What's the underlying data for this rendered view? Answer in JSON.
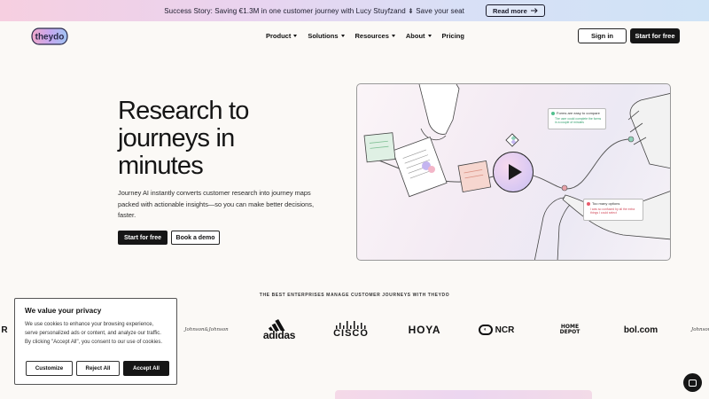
{
  "announcement": {
    "text": "Success Story: Saving €1.3M in one customer journey with Lucy Stuyfzand ⇟ Save your seat",
    "read_more": "Read more"
  },
  "nav": {
    "logo_text": "theydo",
    "items": [
      "Product",
      "Solutions",
      "Resources",
      "About",
      "Pricing"
    ],
    "sign_in": "Sign in",
    "start_free": "Start for free"
  },
  "hero": {
    "title_line1": "Research to",
    "title_line2": "journeys in",
    "title_line3": "minutes",
    "subtitle": "Journey AI instantly converts customer research into journey maps packed with actionable insights—so you can make better decisions, faster.",
    "cta_primary": "Start for free",
    "cta_secondary": "Book a demo"
  },
  "video": {
    "card_positive_title": "Forms are easy to compare",
    "card_positive_sub": "The user could complete the forms in a couple of minutes",
    "card_negative_title": "Too many options",
    "card_negative_sub": "I was so confused by all the extra things I could select"
  },
  "logos": {
    "heading": "THE BEST ENTERPRISES MANAGE CUSTOMER JOURNEYS WITH THEYDO",
    "partial_left": "R",
    "jj": "Johnson&Johnson",
    "adidas": "adidas",
    "cisco": "CISCO",
    "hoya": "HOYA",
    "ncr": "NCR",
    "home_depot_1": "HOME",
    "home_depot_2": "DEPOT",
    "bol": "bol.com",
    "jj_right": "Johnson"
  },
  "cookie": {
    "title": "We value your privacy",
    "body": "We use cookies to enhance your browsing experience, serve personalized ads or content, and analyze our traffic. By clicking \"Accept All\", you consent to our use of cookies.",
    "customize": "Customize",
    "reject": "Reject All",
    "accept": "Accept All"
  },
  "colors": {
    "primary_button": "#161616",
    "positive": "#52c08e",
    "negative": "#e85c6c"
  },
  "icons": [
    "arrow-right-icon",
    "chevron-down-icon",
    "play-icon",
    "chat-icon"
  ]
}
